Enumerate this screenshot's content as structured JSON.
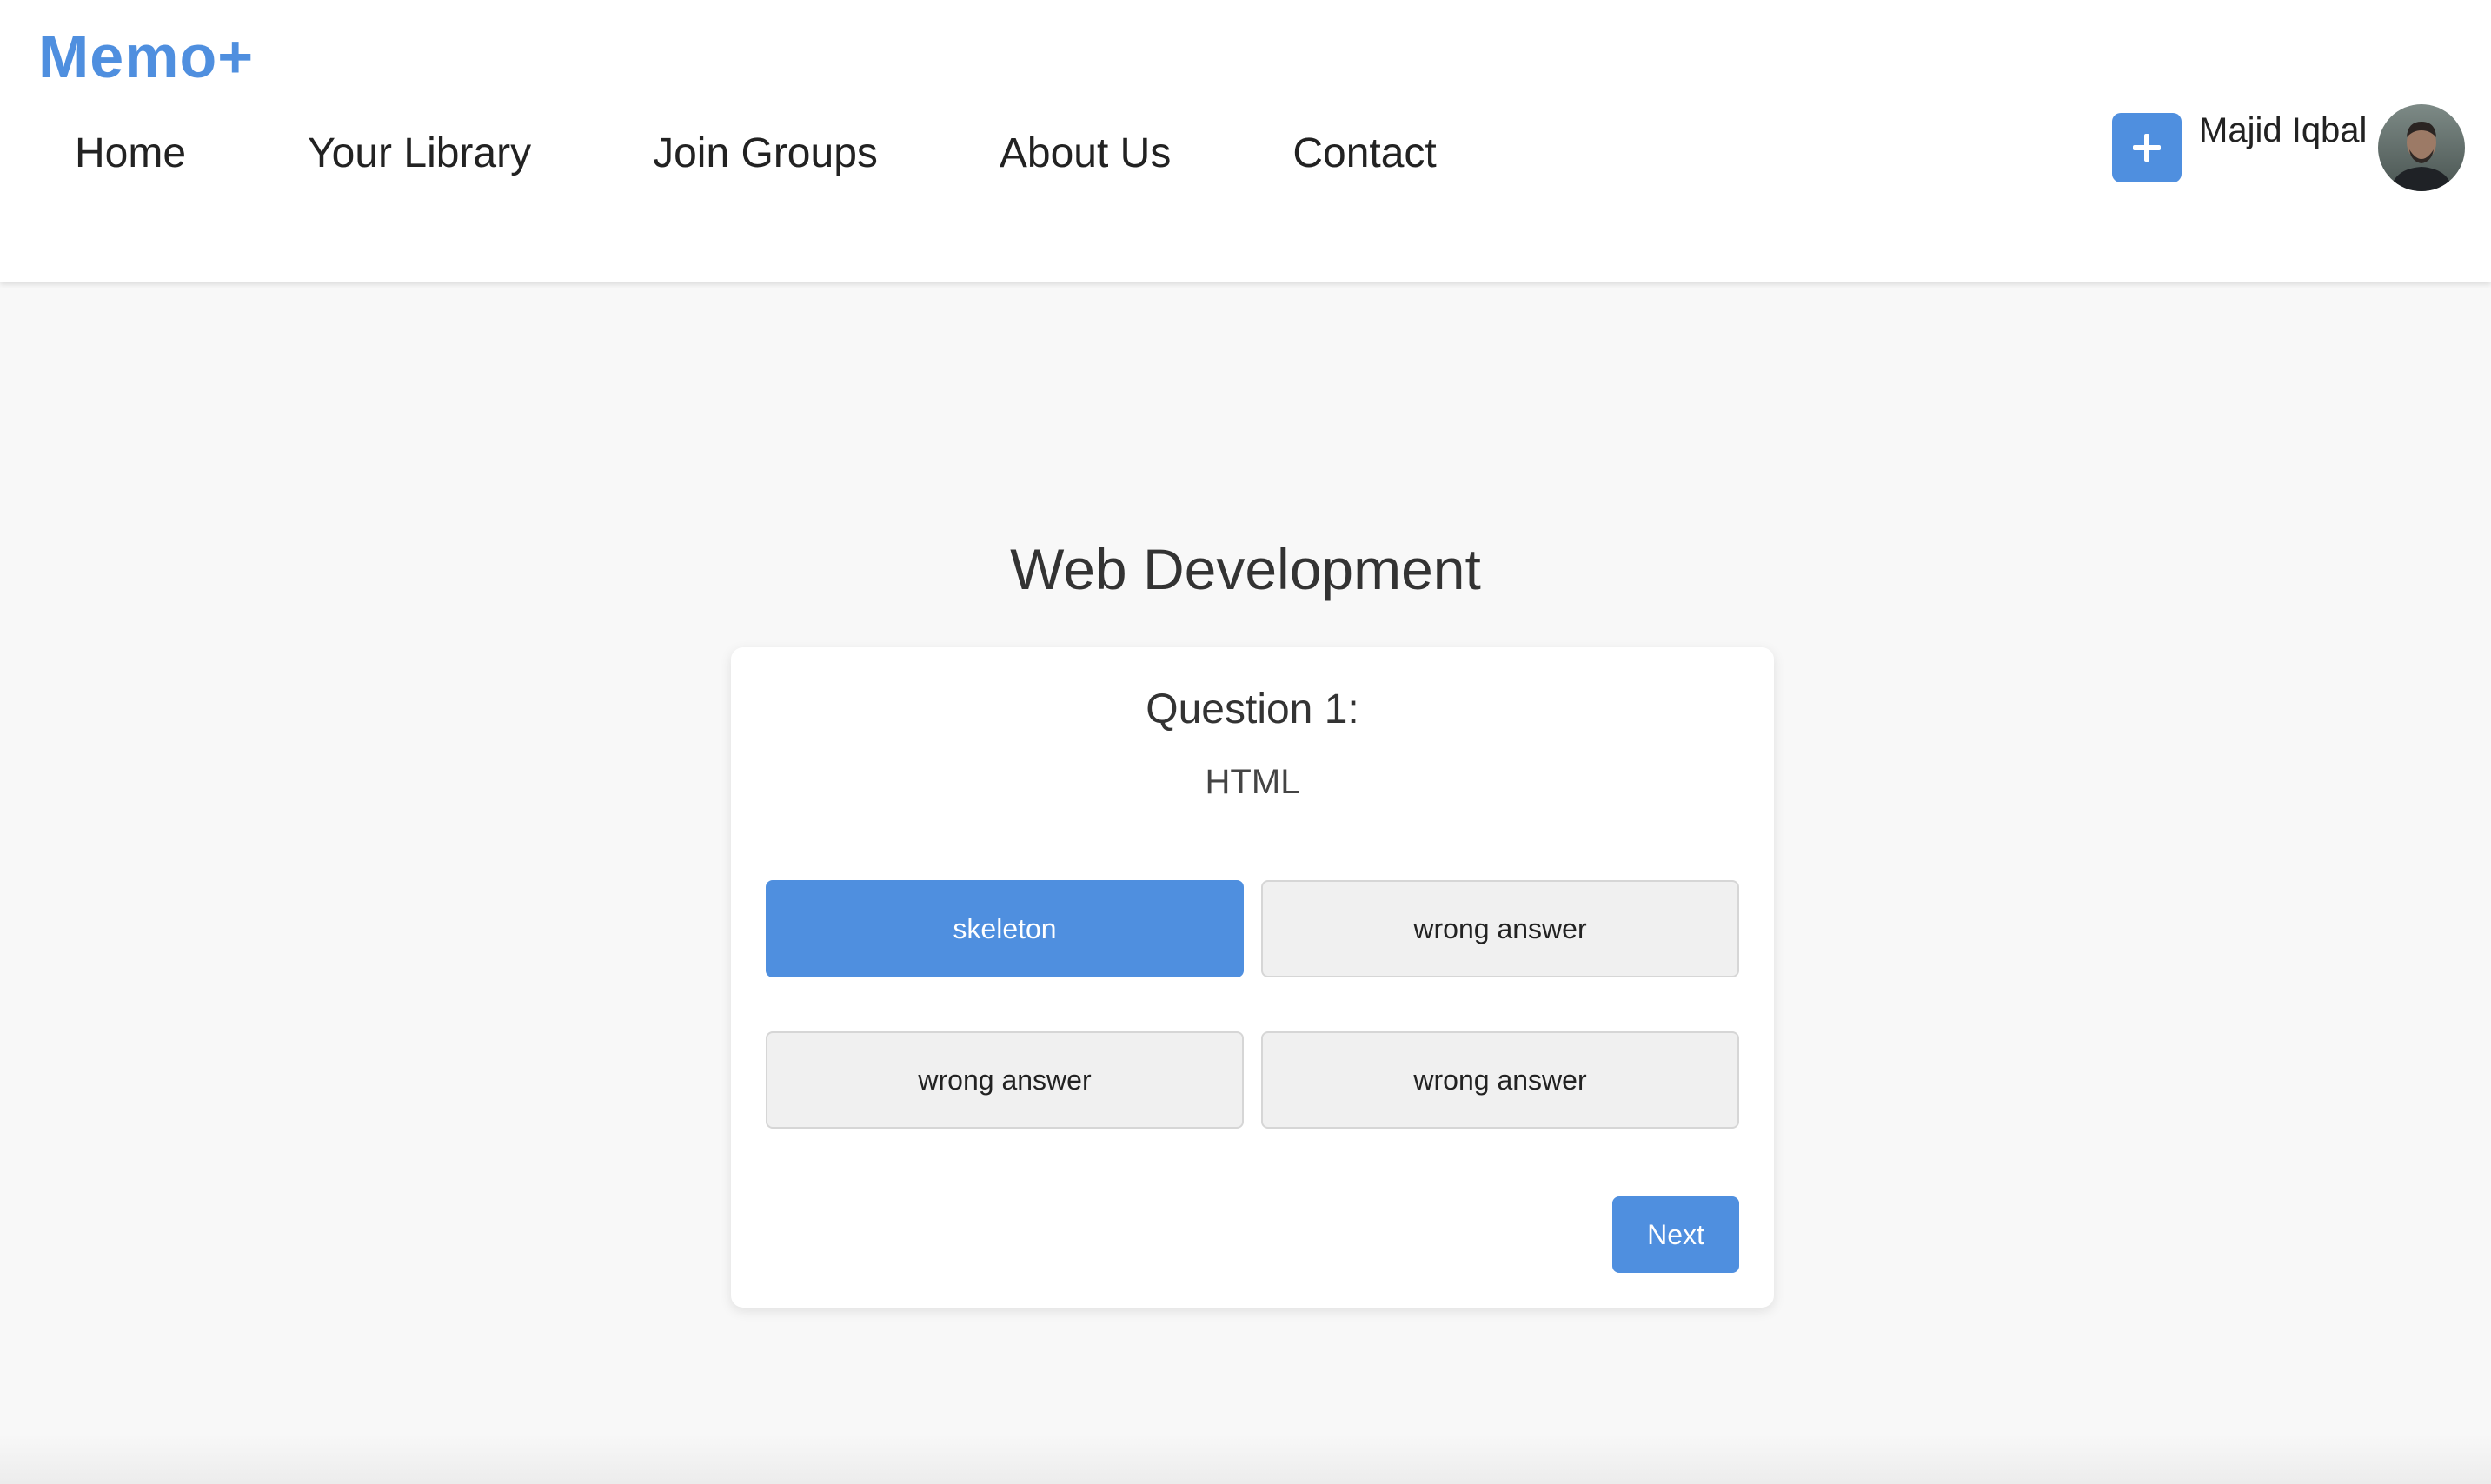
{
  "brand": {
    "logo_text": "Memo+"
  },
  "nav": {
    "items": [
      {
        "label": "Home"
      },
      {
        "label": "Your Library"
      },
      {
        "label": "Join Groups"
      },
      {
        "label": "About Us"
      },
      {
        "label": "Contact"
      }
    ]
  },
  "user": {
    "name": "Majid Iqbal",
    "add_icon": "plus-icon",
    "avatar_icon": "user-avatar"
  },
  "quiz": {
    "deck_title": "Web Development",
    "question_label": "Question 1:",
    "question_text": "HTML",
    "answers": [
      {
        "label": "skeleton",
        "selected": true
      },
      {
        "label": "wrong answer",
        "selected": false
      },
      {
        "label": "wrong answer",
        "selected": false
      },
      {
        "label": "wrong answer",
        "selected": false
      }
    ],
    "next_label": "Next"
  },
  "colors": {
    "accent": "#4f8fdf",
    "text": "#333333",
    "background": "#f8f8f8"
  }
}
